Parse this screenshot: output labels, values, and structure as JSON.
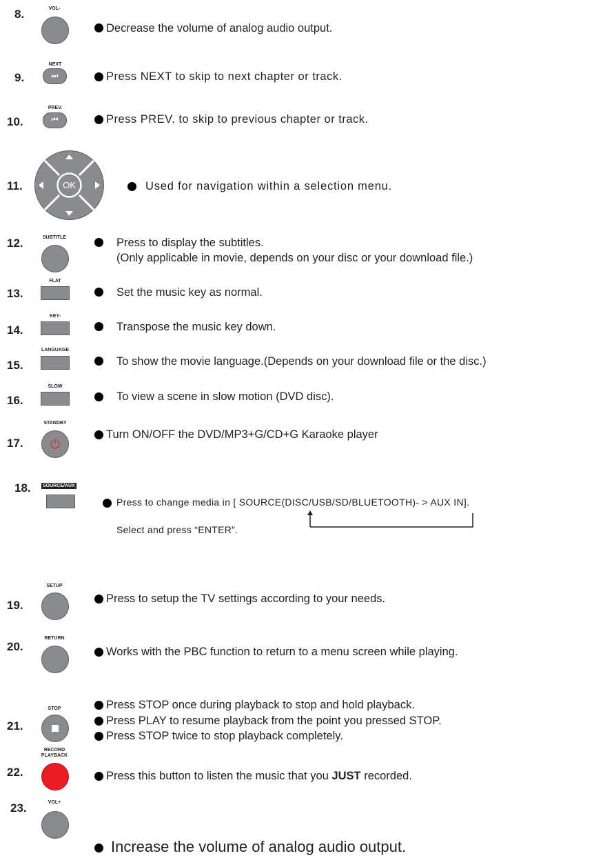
{
  "items": {
    "i8": {
      "num": "8.",
      "caption": "VOL-",
      "text": "Decrease the volume of analog audio output."
    },
    "i9": {
      "num": "9.",
      "caption": "NEXT",
      "icon": "⏭",
      "text": "Press NEXT  to skip to next chapter or track."
    },
    "i10": {
      "num": "10.",
      "caption": "PREV.",
      "icon": "⏮",
      "text": "Press PREV. to skip to previous chapter or track."
    },
    "i11": {
      "num": "11.",
      "center_label": "OK",
      "text": "Used for navigation within a selection menu."
    },
    "i12": {
      "num": "12.",
      "caption": "SUBTITLE",
      "text": "Press to display the subtitles.",
      "text2": "(Only applicable in movie, depends on your disc or your download file.)"
    },
    "i13": {
      "num": "13.",
      "caption": "FLAT",
      "text": "Set the music key as normal."
    },
    "i14": {
      "num": "14.",
      "caption": "KEY-",
      "text": "Transpose the music key down."
    },
    "i15": {
      "num": "15.",
      "caption": "LANGUAGE",
      "text": "To show the movie language.(Depends on your download file or the disc.)"
    },
    "i16": {
      "num": "16.",
      "caption": "SLOW",
      "text": "To view a scene in slow motion (DVD disc)."
    },
    "i17": {
      "num": "17.",
      "caption": "STANDBY",
      "icon": "⏻",
      "text": "Turn ON/OFF the DVD/MP3+G/CD+G Karaoke player"
    },
    "i18": {
      "num": "18.",
      "caption": "SOURCE/AUX",
      "text": "Press to change media in [ SOURCE(DISC/USB/SD/BLUETOOTH)- > AUX IN].",
      "text2": "Select and press “ENTER”."
    },
    "i19": {
      "num": "19.",
      "caption": "SETUP",
      "text": "Press to setup the TV settings according to your needs."
    },
    "i20": {
      "num": "20.",
      "caption": "RETURN",
      "text": "Works with the PBC function to return to a menu screen while playing."
    },
    "i21": {
      "num": "21.",
      "caption": "STOP",
      "lines": [
        "Press STOP once during playback to stop and hold playback.",
        "Press PLAY to resume playback from the point you pressed STOP.",
        "Press STOP twice to stop playback completely."
      ]
    },
    "i22": {
      "num": "22.",
      "caption1": "RECORD",
      "caption2": "PLAYBACK",
      "text_a": "Press this button to listen the music that you ",
      "text_b": "JUST",
      "text_c": " recorded."
    },
    "i23": {
      "num": "23.",
      "caption": "VOL+",
      "text": "Increase the volume of analog audio output."
    }
  },
  "colors": {
    "button_gray": "#8a8b8f",
    "standby_icon": "#e0262b",
    "record_button": "#ed1c24",
    "text": "#231f20"
  },
  "icons": {
    "play_next": "skip-next-icon",
    "play_prev": "skip-previous-icon",
    "power": "power-icon",
    "stop": "stop-icon",
    "arrows": "direction-arrow-icon"
  }
}
